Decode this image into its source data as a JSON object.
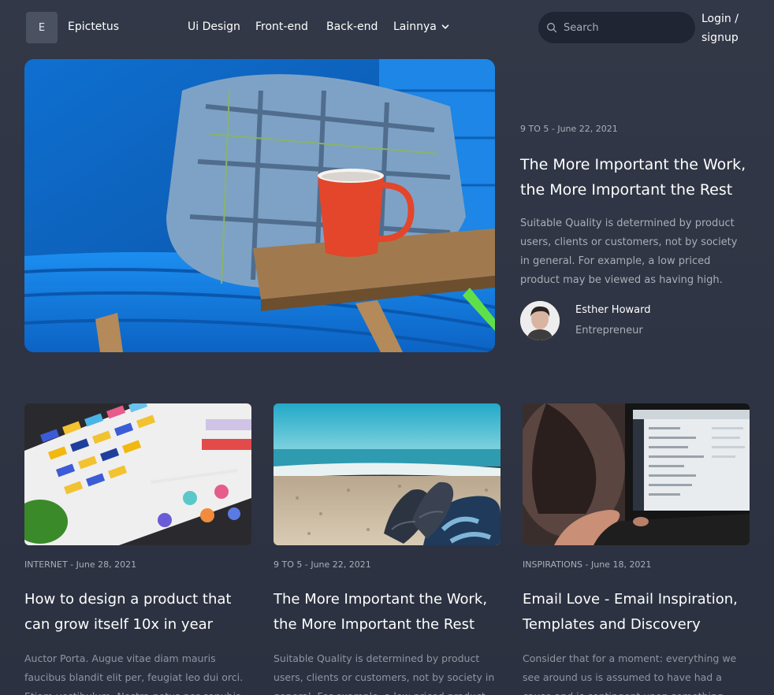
{
  "brand": {
    "logo_letter": "E",
    "name": "Epictetus"
  },
  "nav": {
    "items": [
      {
        "label": "Ui Design"
      },
      {
        "label": "Front-end"
      },
      {
        "label": "Back-end"
      },
      {
        "label": "Lainnya",
        "has_dropdown": true
      }
    ]
  },
  "search": {
    "placeholder": "Search",
    "value": ""
  },
  "auth": {
    "label": "Login / signup"
  },
  "featured": {
    "image": "blue-sofa-red-mug",
    "category": "9 TO 5",
    "date": "June 22, 2021",
    "meta": "9 TO 5 - June 22, 2021",
    "title": "The More Important the Work, the More Important the Rest",
    "description": "Suitable Quality is determined by product users, clients or customers, not by society in general. For example, a low priced product may be viewed as having high.",
    "author": {
      "name": "Esther Howard",
      "role": "Entrepreneur"
    }
  },
  "posts": [
    {
      "image": "color-swatches",
      "meta": "INTERNET - June 28, 2021",
      "title": "How to design a product that can grow itself 10x in year",
      "description": "Auctor Porta. Augue vitae diam mauris faucibus blandit elit per, feugiat leo dui orci. Etiam vestibulum. Nostra netus per conubia dolor."
    },
    {
      "image": "beach-boots",
      "meta": "9 TO 5 - June 22, 2021",
      "title": "The More Important the Work, the More Important the Rest",
      "description": "Suitable Quality is determined by product users, clients or customers, not by society in general. For example, a low priced product may be viewed as having high."
    },
    {
      "image": "laptop-woman",
      "meta": "INSPIRATIONS - June 18, 2021",
      "title": "Email Love - Email Inspiration, Templates and Discovery",
      "description": "Consider that for a moment: everything we see around us is assumed to have had a cause and is contingent upon something else."
    }
  ],
  "colors": {
    "background": "#2f3545",
    "search_bg": "#1f2533",
    "muted_text": "#a9aeb8",
    "accent_blue": "#1f7fd8"
  }
}
